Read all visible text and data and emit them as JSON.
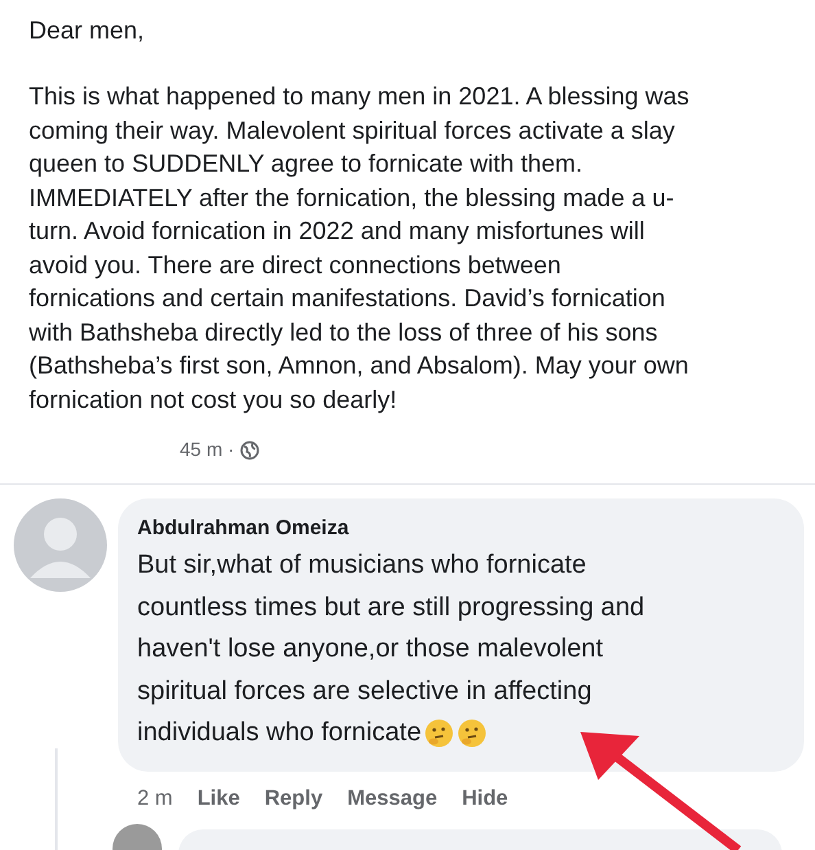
{
  "post": {
    "greeting": "Dear men,",
    "body_lines": [
      "This is what happened to many men in 2021. A blessing was",
      "coming their way. Malevolent spiritual forces activate a slay",
      "queen to SUDDENLY agree to fornicate with them.",
      "IMMEDIATELY after the fornication, the blessing made a u-",
      "turn. Avoid fornication in 2022 and many misfortunes will",
      "avoid you. There are direct connections between",
      "fornications and certain manifestations. David’s fornication",
      "with Bathsheba directly led to the loss of three of his sons",
      "(Bathsheba’s first son, Amnon, and Absalom). May your own",
      "fornication not cost you so dearly!"
    ],
    "time": "45 m ·"
  },
  "comment": {
    "author": "Abdulrahman Omeiza",
    "text_lines": [
      "But sir,what of musicians who fornicate",
      "countless times but are still progressing and",
      "haven't lose anyone,or those malevolent",
      "spiritual forces are selective in affecting",
      "individuals who fornicate"
    ],
    "time": "2 m",
    "actions": [
      "Like",
      "Reply",
      "Message",
      "Hide"
    ]
  }
}
